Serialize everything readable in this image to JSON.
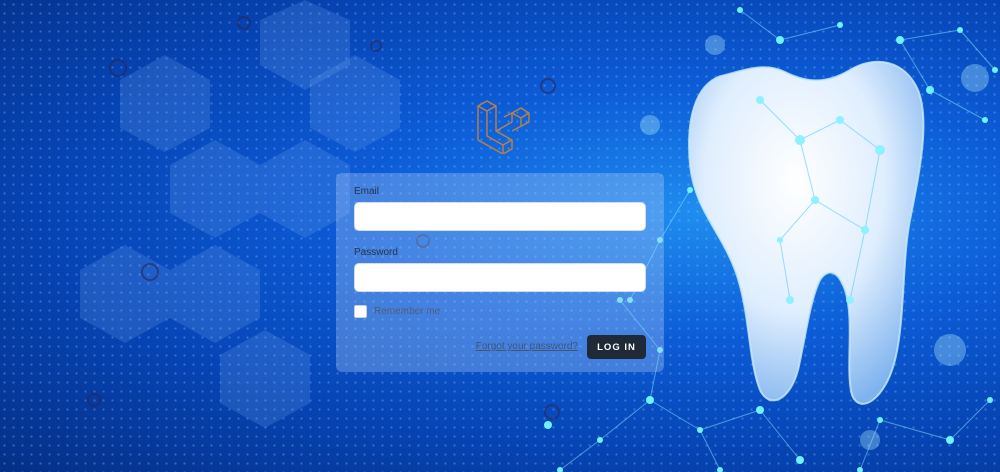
{
  "login": {
    "email_label": "Email",
    "email_value": "",
    "password_label": "Password",
    "password_value": "",
    "remember_label": "Remember me",
    "remember_checked": false,
    "forgot_label": "Forgot your password?",
    "login_label": "LOG IN"
  },
  "colors": {
    "background": "#0a57cf",
    "card": "#a0c3f5",
    "button": "#1f2937",
    "logo": "#c08040"
  },
  "icons": {
    "logo": "laravel-logo-icon"
  }
}
